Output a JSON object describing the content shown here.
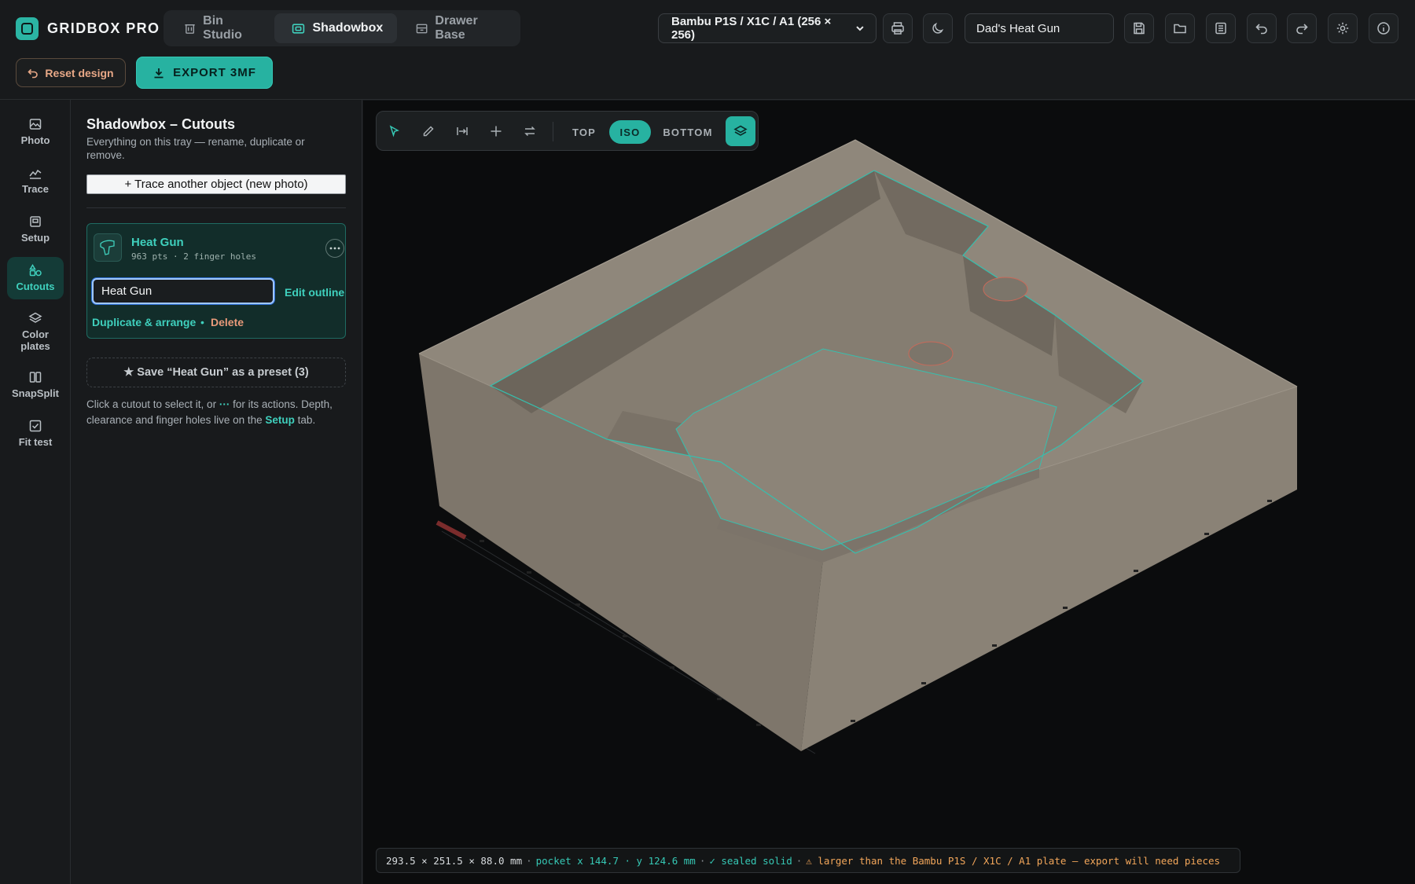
{
  "app": {
    "name": "GRIDBOX PRO"
  },
  "tabs": [
    {
      "label": "Bin Studio",
      "icon": "bin-icon"
    },
    {
      "label": "Shadowbox",
      "icon": "shadowbox-icon",
      "active": true
    },
    {
      "label": "Drawer Base",
      "icon": "drawer-icon"
    }
  ],
  "printer": {
    "selected": "Bambu P1S / X1C / A1 (256 × 256)"
  },
  "project": {
    "name": "Dad's Heat Gun"
  },
  "actions": {
    "reset": "Reset design",
    "export": "EXPORT 3MF"
  },
  "toolbar_icons": [
    "print-icon",
    "theme-icon",
    "save-icon",
    "open-folder-icon",
    "library-icon",
    "undo-icon",
    "redo-icon",
    "settings-icon",
    "info-icon"
  ],
  "nav": [
    {
      "label": "Photo",
      "icon": "photo-icon"
    },
    {
      "label": "Trace",
      "icon": "trace-icon"
    },
    {
      "label": "Setup",
      "icon": "setup-icon"
    },
    {
      "label": "Cutouts",
      "icon": "cutouts-icon",
      "active": true
    },
    {
      "label": "Color plates",
      "icon": "layers-icon"
    },
    {
      "label": "SnapSplit",
      "icon": "snapsplit-icon"
    },
    {
      "label": "Fit test",
      "icon": "fit-test-icon"
    }
  ],
  "panel": {
    "title": "Shadowbox – Cutouts",
    "subtitle": "Everything on this tray — rename, duplicate or remove.",
    "trace_button": "+ Trace another object (new photo)",
    "cutout": {
      "name": "Heat Gun",
      "meta": "963 pts · 2 finger holes",
      "rename_value": "Heat Gun",
      "edit_outline": "Edit outline",
      "duplicate": "Duplicate & arrange",
      "bullet": "•",
      "delete": "Delete"
    },
    "preset_button": "★ Save “Heat Gun” as a preset (3)",
    "hint": {
      "part1": "Click a cutout to select it, or ",
      "more_glyph": "···",
      "part2": " for its actions. Depth, clearance and finger holes live on the ",
      "setup_link": "Setup",
      "part3": " tab."
    }
  },
  "viewport": {
    "views": [
      "TOP",
      "ISO",
      "BOTTOM"
    ],
    "active_view": "ISO",
    "tools": [
      "select-icon",
      "pencil-icon",
      "measure-icon",
      "crosshair-icon",
      "flip-icon"
    ]
  },
  "status": {
    "dims": "293.5 × 251.5 × 88.0 mm",
    "sep": "·",
    "pocket": "pocket x 144.7 · y 124.6 mm",
    "solid": "✓ sealed solid",
    "warning": "⚠ larger than the Bambu P1S / X1C / A1 plate — export will need pieces"
  },
  "colors": {
    "accent": "#27b2a1",
    "warn": "#f2a65a",
    "danger": "#e89a7a",
    "tray": "#8b8276"
  }
}
